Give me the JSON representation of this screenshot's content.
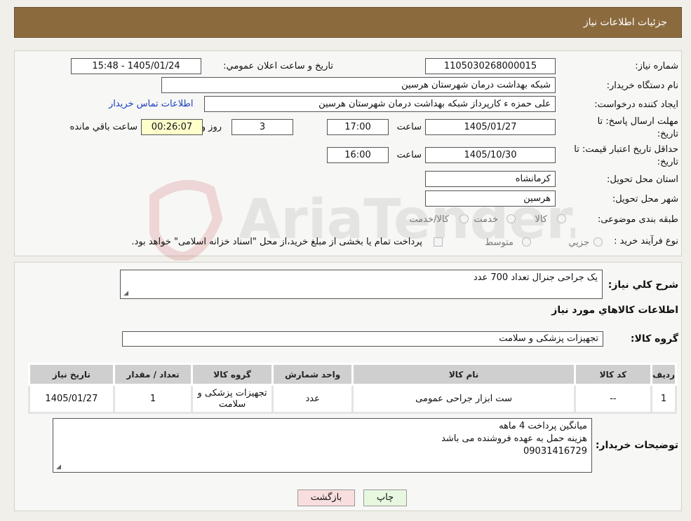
{
  "header": {
    "title": "جزئیات اطلاعات نیاز"
  },
  "form": {
    "need_number_label": "شماره نیاز:",
    "need_number": "1105030268000015",
    "announce_label": "تاریخ و ساعت اعلان عمومي:",
    "announce_value": "1405/01/24 - 15:48",
    "buyer_org_label": "نام دستگاه خريدار:",
    "buyer_org": "شبکه بهداشت درمان شهرستان هرسین",
    "requester_label": "ايجاد کننده درخواست:",
    "requester": "علی حمزه ء کارپرداز شبکه بهداشت درمان شهرستان هرسین",
    "contact_link": "اطلاعات تماس خريدار",
    "deadline_label_1": "مهلت ارسال پاسخ: تا",
    "deadline_label_2": "تاريخ:",
    "deadline_date": "1405/01/27",
    "time_label": "ساعت",
    "deadline_time": "17:00",
    "days_value": "3",
    "days_label": "روز و",
    "remaining_time": "00:26:07",
    "remaining_label": "ساعت باقي مانده",
    "validity_label_1": "حداقل تاريخ اعتبار قيمت: تا",
    "validity_label_2": "تاريخ:",
    "validity_date": "1405/10/30",
    "validity_time": "16:00",
    "province_label": "استان محل تحويل:",
    "province": "کرمانشاه",
    "city_label": "شهر محل تحويل:",
    "city": "هرسین",
    "category_label": "طبقه بندی موضوعی:",
    "category_options": [
      "کالا",
      "خدمت",
      "کالا/خدمت"
    ],
    "process_label": "نوع فرآيند خريد :",
    "process_options": [
      "جزيي",
      "متوسط"
    ],
    "payment_note": "پرداخت تمام يا بخشی از مبلغ خريد،از محل \"اسناد خزانه اسلامی\" خواهد بود."
  },
  "watermark": {
    "text": "AriaTender.neT"
  },
  "summary": {
    "label": "شرح كلي نياز:",
    "value": "یک جراحی جنرال تعداد 700 عدد",
    "goods_info_title": "اطلاعات کالاهاي مورد نياز",
    "goods_group_label": "گروه کالا:",
    "goods_group": "تجهیزات پزشکی و سلامت"
  },
  "table": {
    "headers": [
      "رديف",
      "کد کالا",
      "نام کالا",
      "واحد شمارش",
      "گروه کالا",
      "تعداد / مقدار",
      "تاريخ نياز"
    ],
    "rows": [
      [
        "1",
        "--",
        "ست ابزار جراحی عمومی",
        "عدد",
        "تجهیزات پزشکی و سلامت",
        "1",
        "1405/01/27"
      ]
    ]
  },
  "notes": {
    "label": "توضيحات خريدار:",
    "line1": "میانگین پرداخت 4 ماهه",
    "line2": "هزینه حمل به عهده فروشنده می باشد",
    "line3": "09031416729"
  },
  "buttons": {
    "print": "چاپ",
    "back": "بازگشت"
  },
  "colors": {
    "header_bg": "#8b6b3e",
    "link": "#1a3fbf",
    "back_btn": "#f9dede",
    "print_btn": "#e8f7df"
  }
}
